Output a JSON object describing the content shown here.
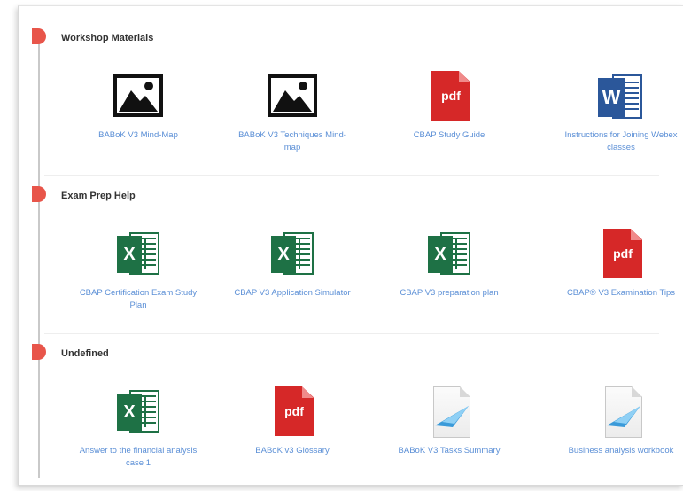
{
  "sections": [
    {
      "title": "Workshop Materials",
      "items": [
        {
          "label": "BABoK V3 Mind-Map",
          "icon": "image-icon"
        },
        {
          "label": "BABoK V3 Techniques Mind-map",
          "icon": "image-icon"
        },
        {
          "label": "CBAP Study Guide",
          "icon": "pdf-icon"
        },
        {
          "label": "Instructions for Joining Webex classes",
          "icon": "word-icon"
        }
      ]
    },
    {
      "title": "Exam Prep Help",
      "items": [
        {
          "label": "CBAP Certification Exam Study Plan",
          "icon": "excel-icon"
        },
        {
          "label": "CBAP V3 Application Simulator",
          "icon": "excel-icon"
        },
        {
          "label": "CBAP V3 preparation plan",
          "icon": "excel-icon"
        },
        {
          "label": "CBAP® V3 Examination Tips",
          "icon": "pdf-icon"
        }
      ]
    },
    {
      "title": "Undefined",
      "items": [
        {
          "label": "Answer to the financial analysis case 1",
          "icon": "excel-icon"
        },
        {
          "label": "BABoK v3 Glossary",
          "icon": "pdf-icon"
        },
        {
          "label": "BABoK V3 Tasks Summary",
          "icon": "file-icon"
        },
        {
          "label": "Business analysis workbook",
          "icon": "file-icon"
        }
      ]
    }
  ],
  "icon_text": {
    "pdf": "pdf",
    "excel": "X",
    "word": "W"
  },
  "colors": {
    "accent_dot": "#e8554a",
    "link": "#5b8fd6",
    "excel": "#1e7145",
    "pdf": "#d62828",
    "word": "#2b579a"
  }
}
